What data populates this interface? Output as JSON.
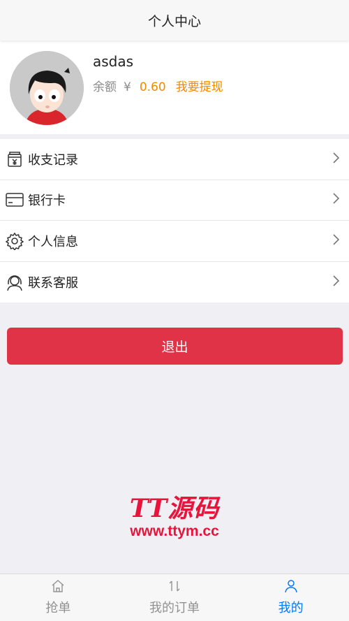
{
  "header": {
    "title": "个人中心"
  },
  "profile": {
    "username": "asdas",
    "balance_label": "余额",
    "currency": "¥",
    "balance": "0.60",
    "withdraw_label": "我要提现"
  },
  "menu": {
    "items": [
      {
        "label": "收支记录",
        "icon": "ledger-icon"
      },
      {
        "label": "银行卡",
        "icon": "card-icon"
      },
      {
        "label": "个人信息",
        "icon": "gear-icon"
      },
      {
        "label": "联系客服",
        "icon": "headset-icon"
      }
    ]
  },
  "actions": {
    "logout_label": "退出"
  },
  "watermark": {
    "brand": "TT源码",
    "url": "www.ttym.cc"
  },
  "tabbar": {
    "tabs": [
      {
        "label": "抢单",
        "icon": "home-icon",
        "active": false
      },
      {
        "label": "我的订单",
        "icon": "sort-icon",
        "active": false
      },
      {
        "label": "我的",
        "icon": "person-icon",
        "active": true
      }
    ]
  },
  "colors": {
    "accent": "#f08a00",
    "danger": "#e03348",
    "active_tab": "#007aff"
  }
}
